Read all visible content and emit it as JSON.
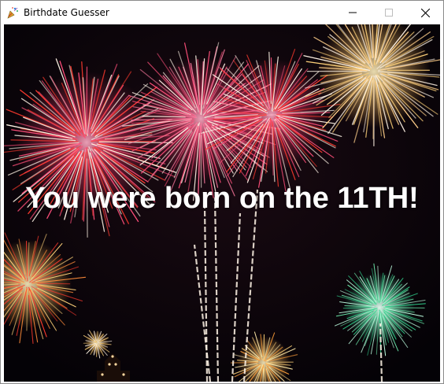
{
  "window": {
    "title": "Birthdate Guesser",
    "icon": "party-popper-icon",
    "controls": [
      "minimize-icon",
      "maximize-icon",
      "close-icon"
    ]
  },
  "main": {
    "message": "You were born on the 11TH!",
    "background": "fireworks-night-sky"
  },
  "colors": {
    "sky": "#050308",
    "text": "#ffffff",
    "firework_pink": "#ff4f7a",
    "firework_red": "#ff3a2e",
    "firework_gold": "#ffd27a",
    "firework_green": "#6ff0b0",
    "firework_white": "#fff4e6"
  }
}
